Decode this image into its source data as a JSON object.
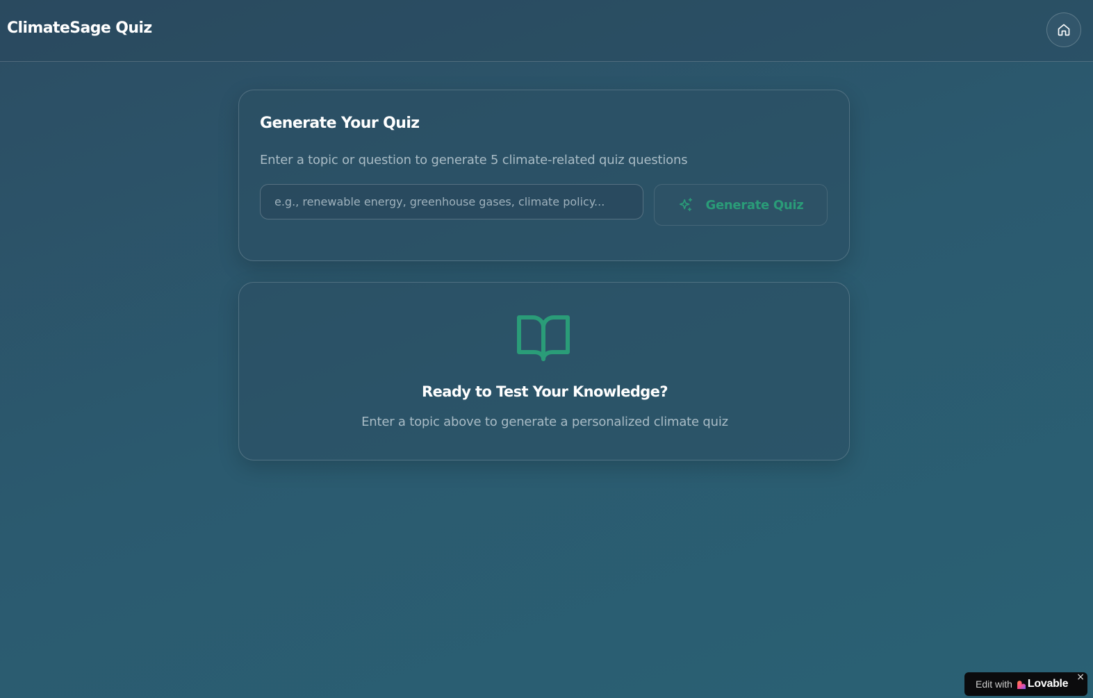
{
  "header": {
    "title": "ClimateSage Quiz",
    "home_icon": "home-icon"
  },
  "generate_card": {
    "title": "Generate Your Quiz",
    "subtitle": "Enter a topic or question to generate 5 climate-related quiz questions",
    "input": {
      "value": "",
      "placeholder": "e.g., renewable energy, greenhouse gases, climate policy..."
    },
    "button": {
      "label": "Generate Quiz",
      "icon": "sparkles-icon"
    }
  },
  "ready_card": {
    "icon": "book-open-icon",
    "title": "Ready to Test Your Knowledge?",
    "subtitle": "Enter a topic above to generate a personalized climate quiz"
  },
  "badge": {
    "prefix": "Edit with",
    "brand": "Lovable",
    "close": "×"
  },
  "colors": {
    "accent": "#2a9c78",
    "background": "#2b5a6f",
    "muted_text": "#a9bcc6"
  }
}
